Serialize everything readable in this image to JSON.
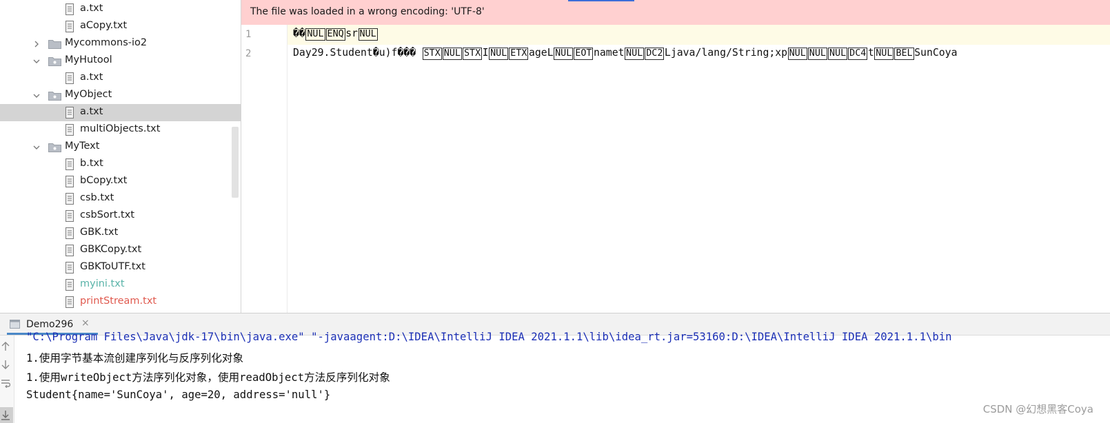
{
  "project_tree": {
    "items": [
      {
        "label": "a.txt",
        "type": "file"
      },
      {
        "label": "aCopy.txt",
        "type": "file"
      },
      {
        "label": "Mycommons-io2",
        "type": "folder",
        "expanded": false
      },
      {
        "label": "MyHutool",
        "type": "folder",
        "expanded": true
      },
      {
        "label": "a.txt",
        "type": "file"
      },
      {
        "label": "MyObject",
        "type": "folder",
        "expanded": true
      },
      {
        "label": "a.txt",
        "type": "file",
        "selected": true
      },
      {
        "label": "multiObjects.txt",
        "type": "file"
      },
      {
        "label": "MyText",
        "type": "folder",
        "expanded": true
      },
      {
        "label": "b.txt",
        "type": "file"
      },
      {
        "label": "bCopy.txt",
        "type": "file"
      },
      {
        "label": "csb.txt",
        "type": "file"
      },
      {
        "label": "csbSort.txt",
        "type": "file"
      },
      {
        "label": "GBK.txt",
        "type": "file"
      },
      {
        "label": "GBKCopy.txt",
        "type": "file"
      },
      {
        "label": "GBKToUTF.txt",
        "type": "file"
      },
      {
        "label": "myini.txt",
        "type": "file",
        "status": "unversioned",
        "color": "#58b3a8"
      },
      {
        "label": "printStream.txt",
        "type": "file",
        "status": "modified",
        "color": "#e05a4f"
      }
    ]
  },
  "editor": {
    "banner": "The file was loaded in a wrong encoding: 'UTF-8'",
    "line_numbers": [
      "1",
      "2"
    ],
    "line1": {
      "bad_chars": "��",
      "ctrl": [
        "NUL",
        "ENQ",
        "NUL"
      ],
      "text": "sr"
    },
    "line2": {
      "t0": "Day29.Student",
      "b0": "�",
      "t1": "u)f",
      "b1": "��� ",
      "c0": "STX",
      "c1": "NUL",
      "c2": "STX",
      "t2": "I",
      "c3": "NUL",
      "c4": "ETX",
      "t3": "ageL",
      "c5": "NUL",
      "c6": "EOT",
      "t4": "namet",
      "c7": "NUL",
      "c8": "DC2",
      "t5": "Ljava/lang/String;xp",
      "c9": "NUL",
      "c10": "NUL",
      "c11": "NUL",
      "c12": "DC4",
      "t6": "t",
      "c13": "NUL",
      "c14": "BEL",
      "t7": "SunCoya"
    }
  },
  "run_panel": {
    "tab_label": "Demo296",
    "close_glyph": "×",
    "toolbar": [
      "up-arrow",
      "down-arrow",
      "soft-wrap",
      "scroll-to-end"
    ],
    "output": [
      "\"C:\\Program Files\\Java\\jdk-17\\bin\\java.exe\" \"-javaagent:D:\\IDEA\\IntelliJ IDEA 2021.1.1\\lib\\idea_rt.jar=53160:D:\\IDEA\\IntelliJ IDEA 2021.1.1\\bin",
      "1.使用字节基本流创建序列化与反序列化对象",
      "1.使用writeObject方法序列化对象，使用readObject方法反序列化对象",
      "Student{name='SunCoya', age=20, address='null'}"
    ],
    "watermark": "CSDN @幻想黑客Coya"
  },
  "colors": {
    "banner_bg": "#ffd0d0",
    "selection_bg": "#d4d4d4",
    "current_line_bg": "#fefbe6",
    "command_text": "#1b2fb5",
    "tab_underline": "#4a88c7"
  }
}
